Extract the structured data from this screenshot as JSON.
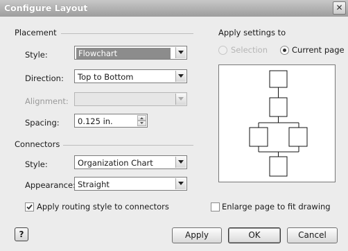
{
  "window": {
    "title": "Configure Layout",
    "close_icon": "close-icon"
  },
  "placement": {
    "heading": "Placement",
    "style_label": "Style:",
    "style_value": "Flowchart",
    "direction_label": "Direction:",
    "direction_value": "Top to Bottom",
    "alignment_label": "Alignment:",
    "alignment_value": "",
    "spacing_label": "Spacing:",
    "spacing_value": "0.125 in."
  },
  "connectors": {
    "heading": "Connectors",
    "style_label": "Style:",
    "style_value": "Organization Chart",
    "appearance_label": "Appearance:",
    "appearance_value": "Straight",
    "routing_checkbox_label": "Apply routing style to connectors",
    "routing_checked": true
  },
  "apply_settings": {
    "heading": "Apply settings to",
    "selection_label": "Selection",
    "current_page_label": "Current page",
    "selected": "Current page"
  },
  "enlarge_checkbox_label": "Enlarge page to fit drawing",
  "enlarge_checked": false,
  "buttons": {
    "help": "?",
    "apply": "Apply",
    "ok": "OK",
    "cancel": "Cancel"
  },
  "colors": {
    "title_bar": "#a8a8a8",
    "selected_value_bg": "#8c8c8c"
  }
}
